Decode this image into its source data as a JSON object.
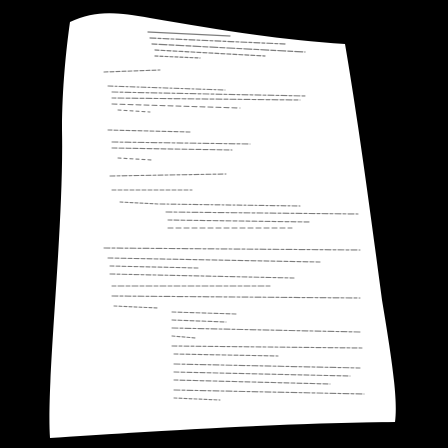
{
  "page": {
    "background_color": "#000000",
    "paper_color": "#ffffff",
    "ink_color": "#7d7d7d"
  }
}
